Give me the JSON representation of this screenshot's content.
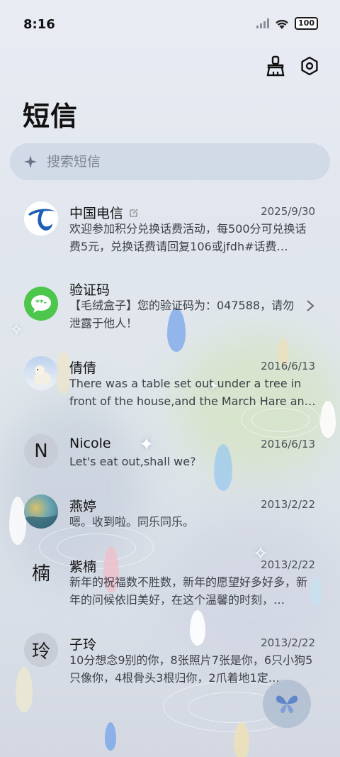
{
  "status": {
    "time": "8:16",
    "battery": "100"
  },
  "page": {
    "title": "短信"
  },
  "search": {
    "placeholder": "搜索短信"
  },
  "conversations": [
    {
      "name": "中国电信",
      "date": "2025/9/30",
      "preview": "欢迎参加积分兑换话费活动，每500分可兑换话费5元，兑换话费请回复106或jfdh#话费…"
    },
    {
      "name": "验证码",
      "date": "",
      "preview": "【毛绒盒子】您的验证码为：047588，请勿泄露于他人！"
    },
    {
      "name": "倩倩",
      "date": "2016/6/13",
      "preview": "There was a table set out under a tree in front of the house,and the March Hare an…"
    },
    {
      "name": "Nicole",
      "date": "2016/6/13",
      "preview": "Let's eat out,shall we?",
      "avatar_letter": "N"
    },
    {
      "name": "燕婷",
      "date": "2013/2/22",
      "preview": "嗯。收到啦。同乐同乐。"
    },
    {
      "name": "紫楠",
      "date": "2013/2/22",
      "preview": "新年的祝福数不胜数，新年的愿望好多好多，新年的问候依旧美好，在这个温馨的时刻，…",
      "avatar_letter": "楠"
    },
    {
      "name": "子玲",
      "date": "2013/2/22",
      "preview": "10分想念9别的你，8张照片7张是你，6只小狗5只像你，4根骨头3根归你，2爪着地1定…",
      "avatar_letter": "玲"
    }
  ],
  "colors": {
    "telecom_blue": "#1f5fb7",
    "message_green": "#4cc64b",
    "accent": "#5f86c8"
  },
  "icons": {
    "clean": "broom-icon",
    "settings": "settings-icon",
    "search": "sparkle-search-icon",
    "compose": "butterfly-compose-icon"
  }
}
